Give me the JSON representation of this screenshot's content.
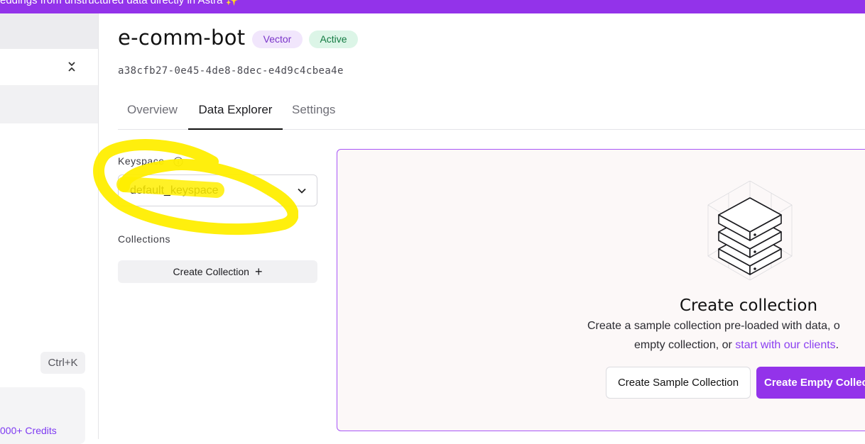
{
  "banner": {
    "text": "eddings from unstructured data directly in Astra ✨"
  },
  "sidebar": {
    "shortcut": "Ctrl+K",
    "credits_text": "000+ Credits"
  },
  "header": {
    "title": "e-comm-bot",
    "badges": {
      "vector": "Vector",
      "active": "Active"
    },
    "uuid": "a38cfb27-0e45-4de8-8dec-e4d9c4cbea4e"
  },
  "tabs": [
    {
      "label": "Overview"
    },
    {
      "label": "Data Explorer"
    },
    {
      "label": "Settings"
    }
  ],
  "keyspace": {
    "label": "Keyspace",
    "value": "default_keyspace"
  },
  "collections": {
    "label": "Collections",
    "create_button": "Create Collection"
  },
  "empty_panel": {
    "title": "Create collection",
    "desc_line1": "Create a sample collection pre-loaded with data, o",
    "desc_line2_prefix": "empty collection, or ",
    "desc_link": "start with our clients",
    "desc_line2_suffix": ".",
    "sample_button": "Create Sample Collection",
    "empty_button": "Create Empty Collec"
  },
  "colors": {
    "accent": "#9333ea",
    "highlight": "#ffee00"
  }
}
